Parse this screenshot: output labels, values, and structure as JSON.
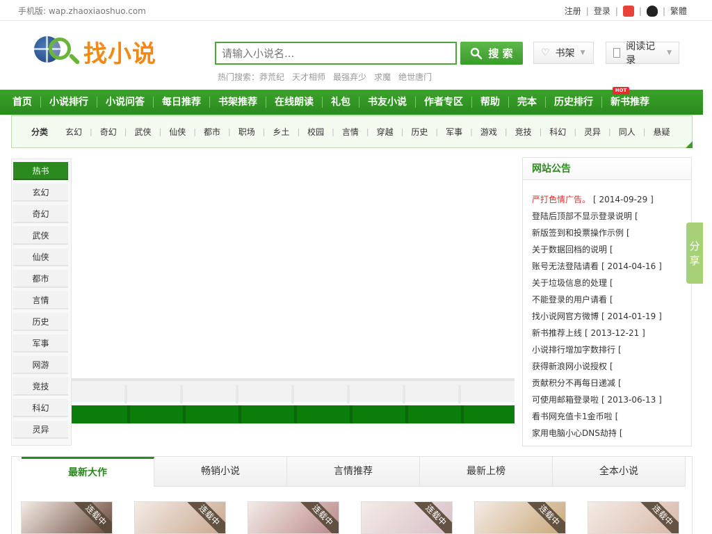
{
  "topbar": {
    "mobile": "手机版: wap.zhaoxiaoshuo.com",
    "register": "注册",
    "login": "登录",
    "traditional": "繁體"
  },
  "logo": {
    "text": "找小说"
  },
  "search": {
    "placeholder": "请输入小说名...",
    "button": "搜 索",
    "hot_label": "热门搜索：",
    "hot": [
      "莽荒纪",
      "天才相师",
      "最强弃少",
      "求魔",
      "绝世唐门"
    ]
  },
  "header": {
    "shelf": "书架",
    "history": "阅读记录"
  },
  "nav": {
    "items": [
      "首页",
      "小说排行",
      "小说问答",
      "每日推荐",
      "书架推荐",
      "在线朗读",
      "礼包",
      "书友小说",
      "作者专区",
      "帮助",
      "完本",
      "历史排行",
      "新书推荐"
    ],
    "hot_badge": "HOT"
  },
  "categories": {
    "title": "分类",
    "items": [
      "玄幻",
      "奇幻",
      "武侠",
      "仙侠",
      "都市",
      "职场",
      "乡土",
      "校园",
      "言情",
      "穿越",
      "历史",
      "军事",
      "游戏",
      "竞技",
      "科幻",
      "灵异",
      "同人",
      "悬疑"
    ]
  },
  "sidebar": {
    "items": [
      "热书",
      "玄幻",
      "奇幻",
      "武侠",
      "仙侠",
      "都市",
      "言情",
      "历史",
      "军事",
      "网游",
      "竞技",
      "科幻",
      "灵异"
    ],
    "active_index": 0
  },
  "notice": {
    "title": "网站公告",
    "items": [
      {
        "text": "严打色情广告。",
        "date": "[ 2014-09-29 ]",
        "highlight": true
      },
      {
        "text": "登陆后顶部不显示登录说明",
        "date": "[",
        "highlight": false
      },
      {
        "text": "新版签到和投票操作示例",
        "date": "[",
        "highlight": false
      },
      {
        "text": "关于数据回档的说明",
        "date": "[",
        "highlight": false
      },
      {
        "text": "账号无法登陆请看",
        "date": "[ 2014-04-16 ]",
        "highlight": false
      },
      {
        "text": "关于垃圾信息的处理",
        "date": "[",
        "highlight": false
      },
      {
        "text": "不能登录的用户请看",
        "date": "[",
        "highlight": false
      },
      {
        "text": "找小说网官方微博",
        "date": "[ 2014-01-19 ]",
        "highlight": false
      },
      {
        "text": "新书推荐上线",
        "date": "[ 2013-12-21 ]",
        "highlight": false
      },
      {
        "text": "小说排行增加字数排行",
        "date": "[",
        "highlight": false
      },
      {
        "text": "获得新浪网小说授权",
        "date": "[",
        "highlight": false
      },
      {
        "text": "贡献积分不再每日递减",
        "date": "[",
        "highlight": false
      },
      {
        "text": "可使用邮箱登录啦",
        "date": "[ 2013-06-13 ]",
        "highlight": false
      },
      {
        "text": "看书网充值卡1金币啦",
        "date": "[",
        "highlight": false
      },
      {
        "text": "家用电脑小心DNS劫持",
        "date": "[",
        "highlight": false
      }
    ]
  },
  "share": {
    "chars": [
      "分",
      "享"
    ]
  },
  "tabs": {
    "items": [
      "最新大作",
      "畅销小说",
      "言情推荐",
      "最新上榜",
      "全本小说"
    ],
    "active_index": 0
  },
  "books": {
    "ribbon": "连载中",
    "covers": [
      "#6a4a3c",
      "#c8a890",
      "#b8888a",
      "#d8c0c8",
      "#c8a878",
      "#d8b8a8"
    ]
  },
  "colors": {
    "brand_green": "#2a8a1d",
    "accent_orange": "#f08a17",
    "alert_red": "#e03030"
  }
}
